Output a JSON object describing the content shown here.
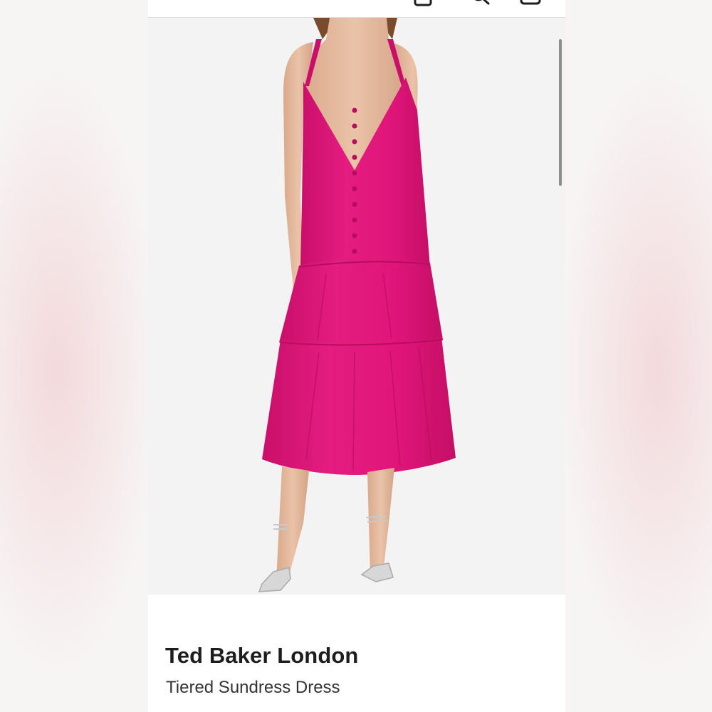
{
  "header": {
    "icons": [
      "share-icon",
      "search-icon",
      "bag-icon"
    ]
  },
  "product": {
    "image_description": "pink tiered sundress",
    "brand": "Ted Baker London",
    "name": "Tiered Sundress Dress",
    "color": "#e0157a"
  }
}
